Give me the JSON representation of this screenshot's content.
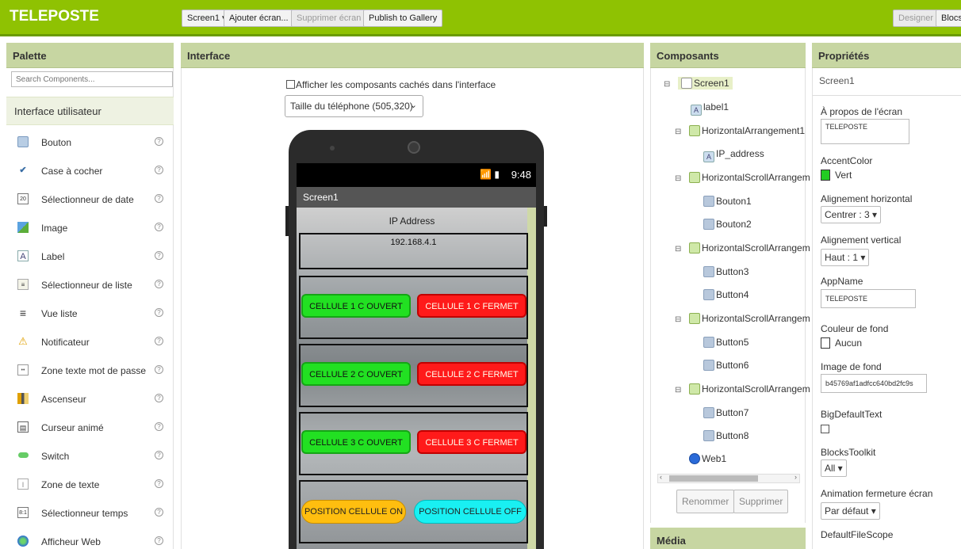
{
  "app": {
    "title": "TELEPOSTE",
    "screen_dropdown": "Screen1 ▾",
    "add_screen": "Ajouter écran...",
    "remove_screen": "Supprimer écran",
    "publish": "Publish to Gallery",
    "designer": "Designer",
    "blocks": "Blocs"
  },
  "palette": {
    "title": "Palette",
    "search_placeholder": "Search Components...",
    "section": "Interface utilisateur",
    "items": [
      {
        "label": "Bouton",
        "icon": "button-icon"
      },
      {
        "label": "Case à cocher",
        "icon": "checkbox-icon"
      },
      {
        "label": "Sélectionneur de date",
        "icon": "datepicker-icon"
      },
      {
        "label": "Image",
        "icon": "image-icon"
      },
      {
        "label": "Label",
        "icon": "label-icon"
      },
      {
        "label": "Sélectionneur de liste",
        "icon": "listpicker-icon"
      },
      {
        "label": "Vue liste",
        "icon": "listview-icon"
      },
      {
        "label": "Notificateur",
        "icon": "notifier-icon"
      },
      {
        "label": "Zone texte mot de passe",
        "icon": "password-icon"
      },
      {
        "label": "Ascenseur",
        "icon": "slider-icon"
      },
      {
        "label": "Curseur animé",
        "icon": "spinner-icon"
      },
      {
        "label": "Switch",
        "icon": "switch-icon"
      },
      {
        "label": "Zone de texte",
        "icon": "textbox-icon"
      },
      {
        "label": "Sélectionneur temps",
        "icon": "timepicker-icon"
      },
      {
        "label": "Afficheur Web",
        "icon": "webviewer-icon"
      }
    ],
    "help": "?"
  },
  "interface": {
    "title": "Interface",
    "hidden_checkbox_label": "Afficher les composants cachés dans l'interface",
    "phone_size": "Taille du téléphone (505,320)",
    "status_time": "9:48",
    "screen_title": "Screen1",
    "ip_label": "IP Address",
    "ip_value": "192.168.4.1",
    "buttons": {
      "c1_open": "CELLULE 1 C OUVERT",
      "c1_closed": "CELLULE 1 C FERMET",
      "c2_open": "CELLULE 2 C OUVERT",
      "c2_closed": "CELLULE 2 C FERMET",
      "c3_open": "CELLULE 3 C OUVERT",
      "c3_closed": "CELLULE 3 C FERMET",
      "pos_on": "POSITION CELLULE ON",
      "pos_off": "POSITION CELLULE OFF"
    }
  },
  "components": {
    "title": "Composants",
    "tree": {
      "screen1": "Screen1",
      "label1": "label1",
      "ha1": "HorizontalArrangement1",
      "ip_address": "IP_address",
      "hsa1": "HorizontalScrollArrangem",
      "bouton1": "Bouton1",
      "bouton2": "Bouton2",
      "hsa2": "HorizontalScrollArrangem",
      "button3": "Button3",
      "button4": "Button4",
      "hsa3": "HorizontalScrollArrangem",
      "button5": "Button5",
      "button6": "Button6",
      "hsa4": "HorizontalScrollArrangem",
      "button7": "Button7",
      "button8": "Button8",
      "web1": "Web1"
    },
    "rename": "Renommer",
    "delete": "Supprimer",
    "media": "Média"
  },
  "properties": {
    "title": "Propriétés",
    "component": "Screen1",
    "about_label": "À propos de l'écran",
    "about_value": "TELEPOSTE",
    "accent_label": "AccentColor",
    "accent_value": "Vert",
    "accent_color": "#22cc22",
    "halign_label": "Alignement horizontal",
    "halign_value": "Centrer : 3 ▾",
    "valign_label": "Alignement vertical",
    "valign_value": "Haut : 1 ▾",
    "appname_label": "AppName",
    "appname_value": "TELEPOSTE",
    "bg_label": "Couleur de fond",
    "bg_value": "Aucun",
    "bgimg_label": "Image de fond",
    "bgimg_value": "b45769af1adfcc640bd2fc9s",
    "bigtext_label": "BigDefaultText",
    "toolkit_label": "BlocksToolkit",
    "toolkit_value": "All ▾",
    "anim_label": "Animation fermeture écran",
    "anim_value": "Par défaut ▾",
    "scope_label": "DefaultFileScope"
  }
}
